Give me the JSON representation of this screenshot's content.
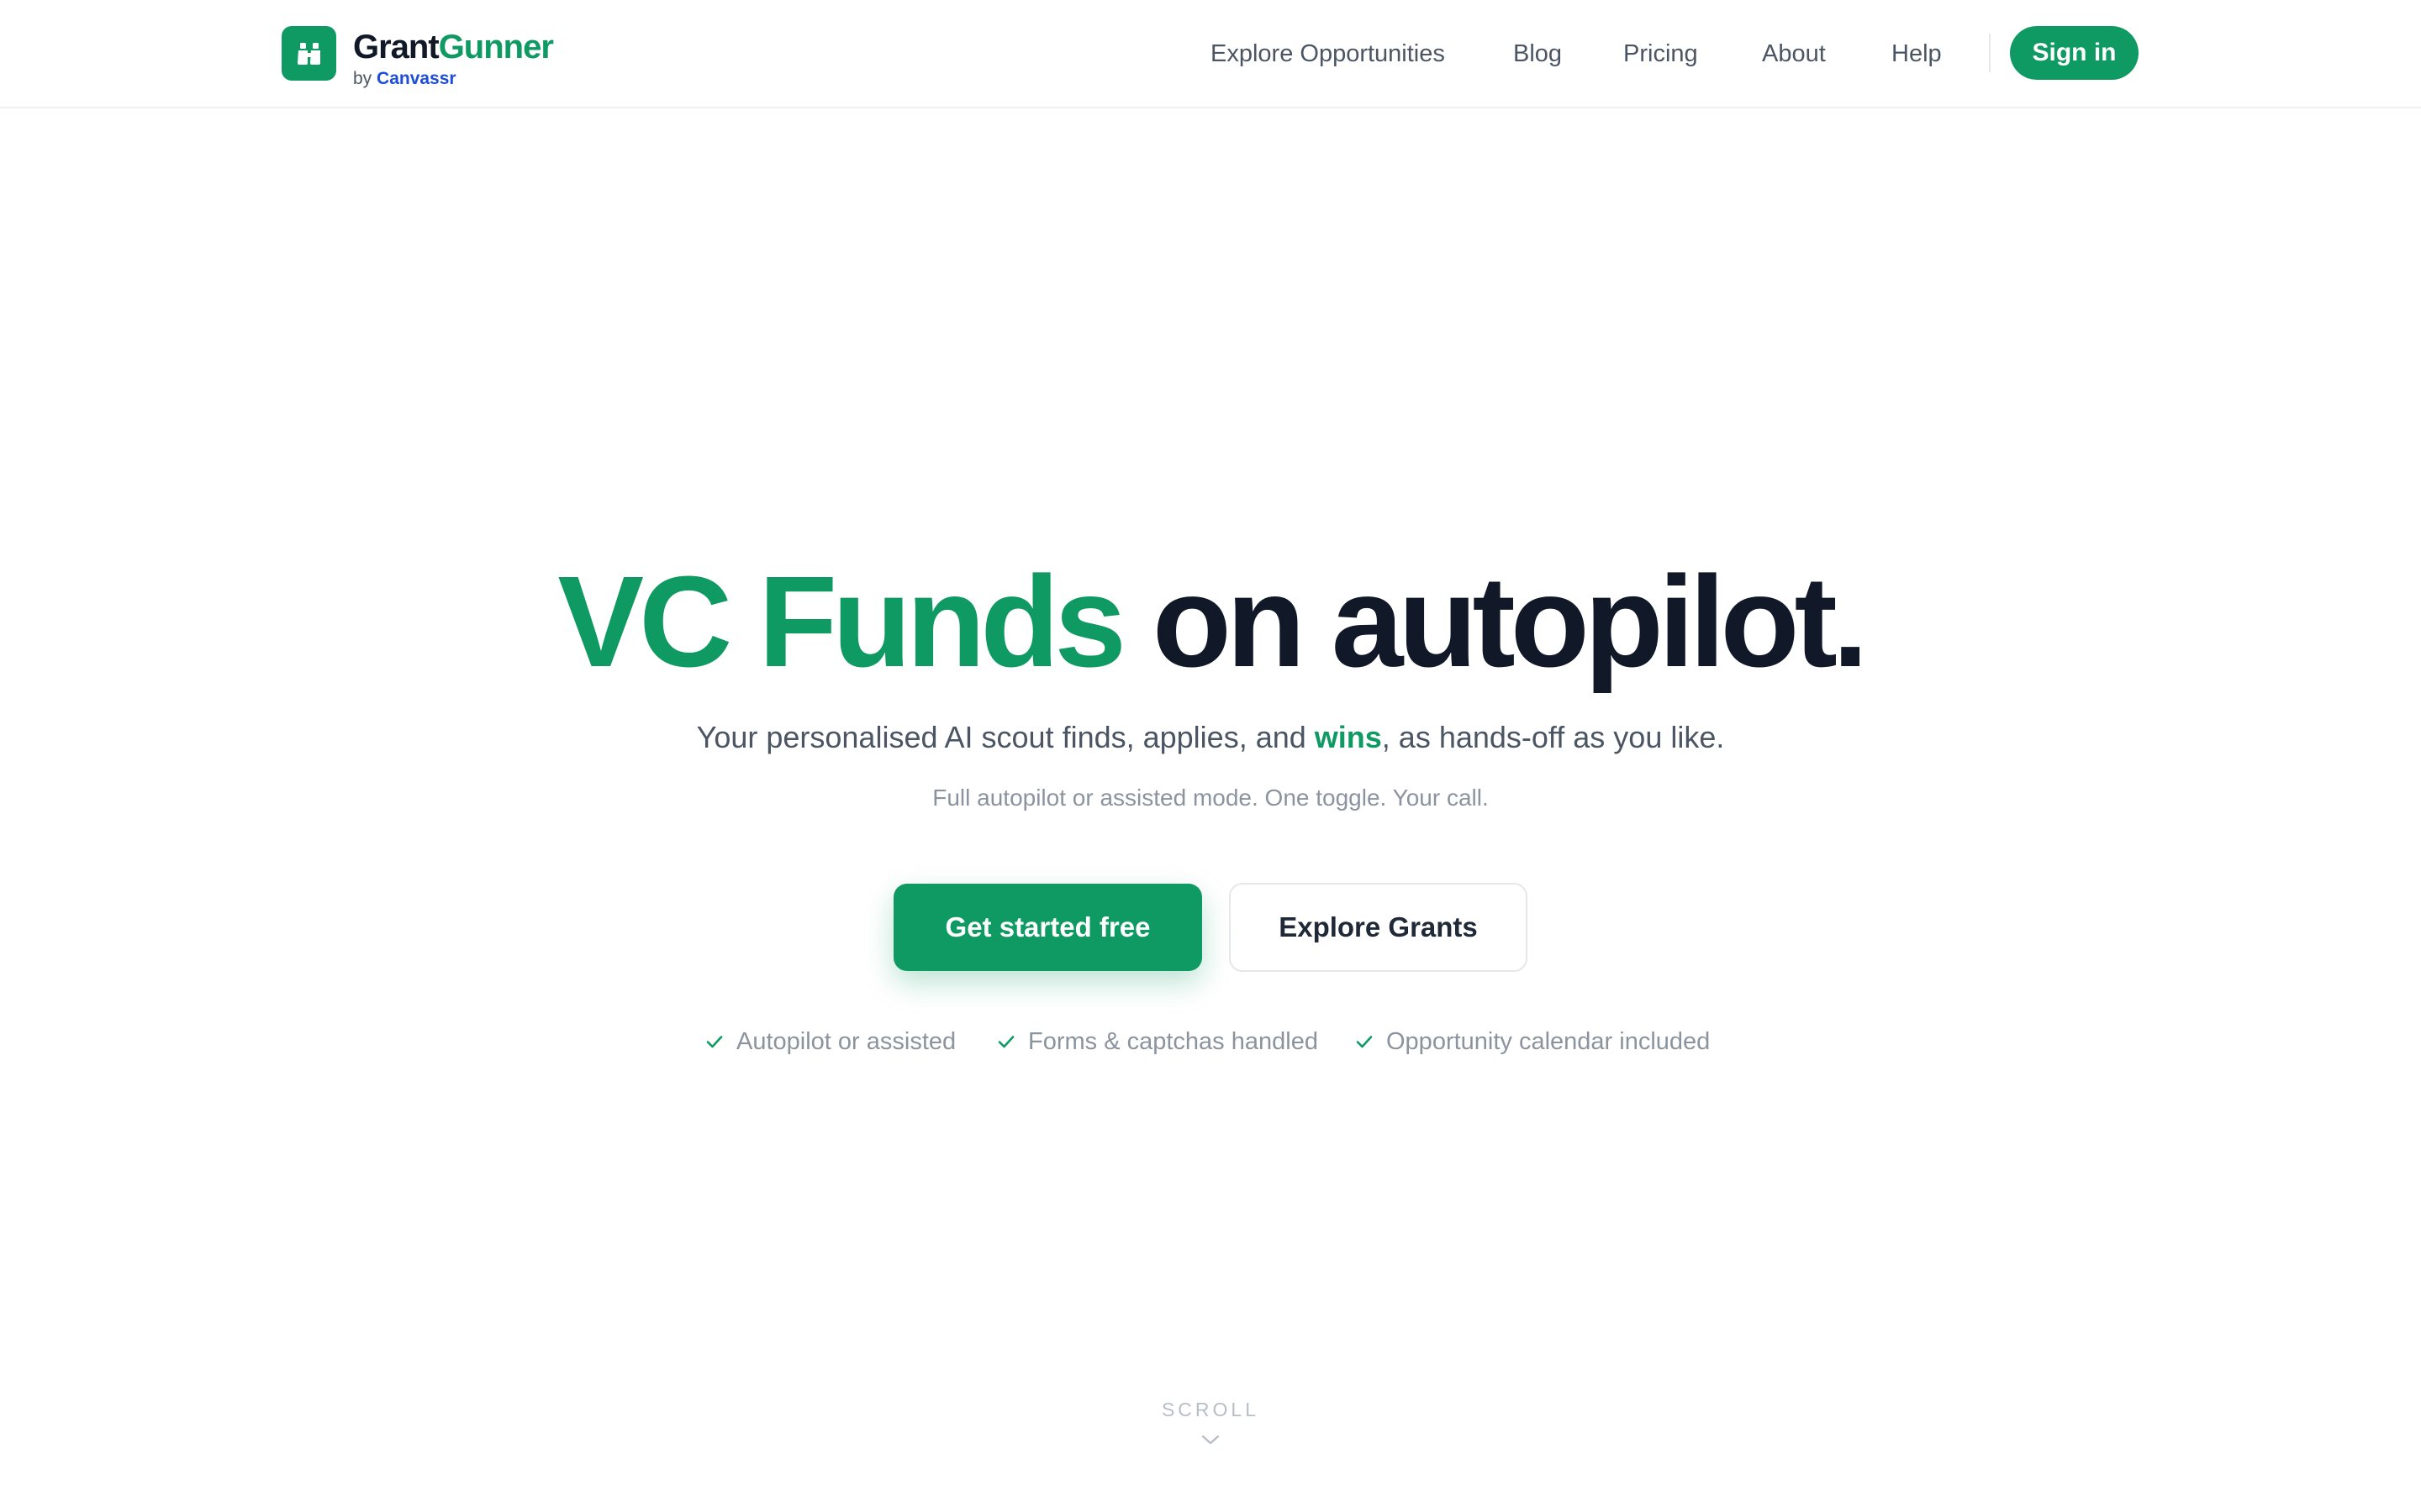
{
  "brand": {
    "name_part1": "Grant",
    "name_part2": "Gunner",
    "by_prefix": "by",
    "company": "Canvassr",
    "logo_icon": "binoculars-icon"
  },
  "nav": {
    "items": [
      {
        "label": "Explore Opportunities"
      },
      {
        "label": "Blog"
      },
      {
        "label": "Pricing"
      },
      {
        "label": "About"
      },
      {
        "label": "Help"
      }
    ],
    "signin_label": "Sign in"
  },
  "hero": {
    "headline_accent": "VC Funds",
    "headline_rest": "on autopilot.",
    "subtitle_before": "Your personalised AI scout finds, applies, and",
    "subtitle_emphasis": "wins",
    "subtitle_after": ", as hands-off as you like.",
    "note": "Full autopilot or assisted mode. One toggle. Your call.",
    "cta_primary": "Get started free",
    "cta_secondary": "Explore Grants",
    "features": [
      {
        "label": "Autopilot or assisted",
        "icon": "check-icon"
      },
      {
        "label": "Forms & captchas handled",
        "icon": "check-icon"
      },
      {
        "label": "Opportunity calendar included",
        "icon": "check-icon"
      }
    ],
    "scroll_label": "SCROLL"
  },
  "colors": {
    "brand_green": "#0f9a63",
    "text_dark": "#111827",
    "text_muted": "#4b5563",
    "text_light": "#8b949e",
    "link_blue": "#1d4ed8"
  }
}
